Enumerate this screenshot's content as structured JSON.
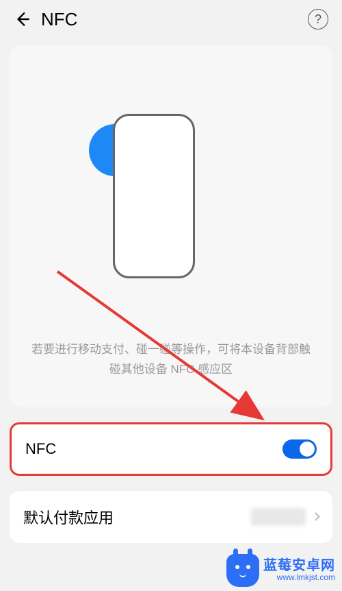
{
  "header": {
    "title": "NFC"
  },
  "illustration": {
    "hint": "若要进行移动支付、碰一碰等操作，可将本设备背部触碰其他设备 NFC 感应区"
  },
  "settings": {
    "nfc_toggle": {
      "label": "NFC",
      "enabled": true
    },
    "default_payment": {
      "label": "默认付款应用"
    }
  },
  "watermark": {
    "title": "蓝莓安卓网",
    "url": "www.lmkjst.com"
  }
}
